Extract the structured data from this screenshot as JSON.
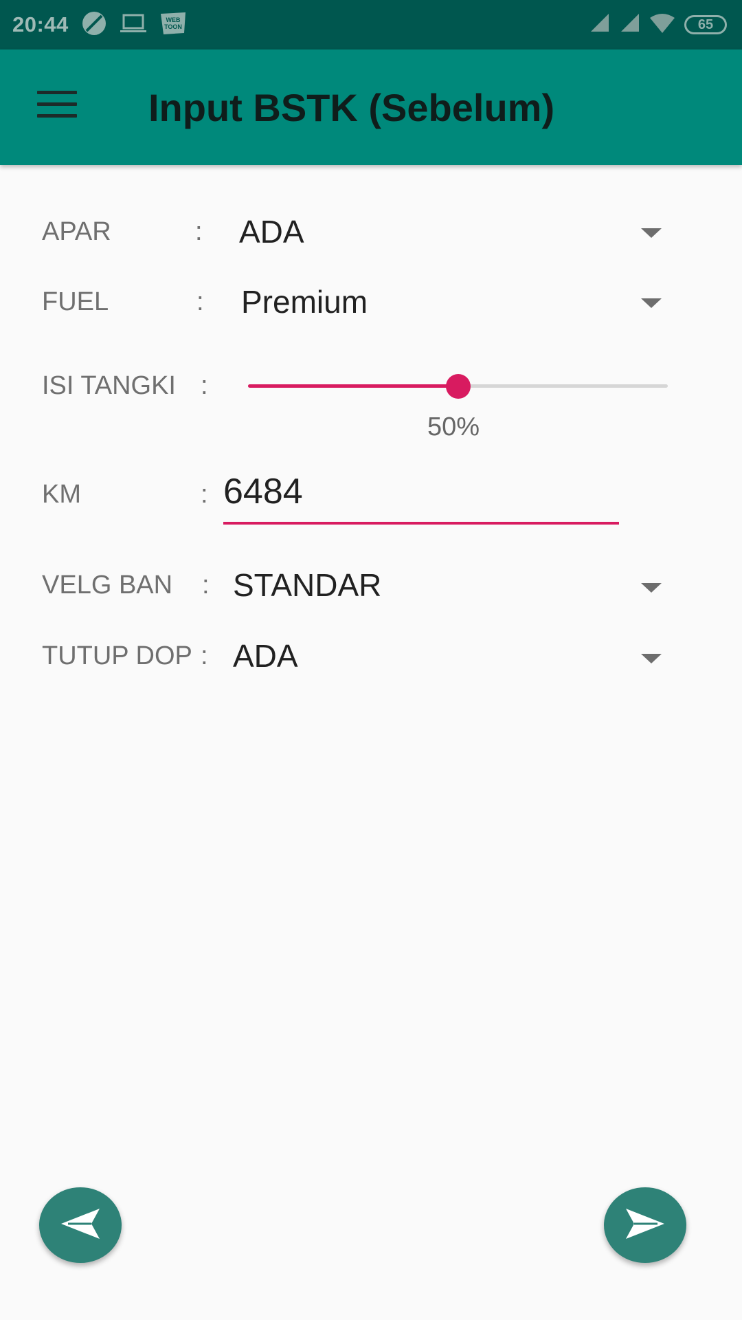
{
  "status_bar": {
    "time": "20:44",
    "icons": [
      "data-saver-icon",
      "laptop-icon",
      "webtoon-icon"
    ],
    "right_icons": [
      "signal-icon",
      "signal-icon",
      "wifi-icon"
    ],
    "battery": "65"
  },
  "app_bar": {
    "menu_icon": "menu-icon",
    "title": "Input BSTK (Sebelum)",
    "color": "#00897b"
  },
  "form": {
    "apar": {
      "label": "APAR",
      "colon": ":",
      "value": "ADA"
    },
    "fuel": {
      "label": "FUEL",
      "colon": ":",
      "value": "Premium"
    },
    "isi_tangki": {
      "label": "ISI TANGKI",
      "colon": ":",
      "percent": 50,
      "display": "50%"
    },
    "km": {
      "label": "KM",
      "colon": ":",
      "value": "6484"
    },
    "velg_ban": {
      "label": "VELG BAN",
      "colon": ":",
      "value": "STANDAR"
    },
    "tutup_dop": {
      "label": "TUTUP DOP",
      "colon": ":",
      "value": "ADA"
    }
  },
  "fabs": {
    "back_icon": "send-back-icon",
    "next_icon": "send-icon",
    "color": "#2e8277"
  },
  "accent": "#d81b60"
}
